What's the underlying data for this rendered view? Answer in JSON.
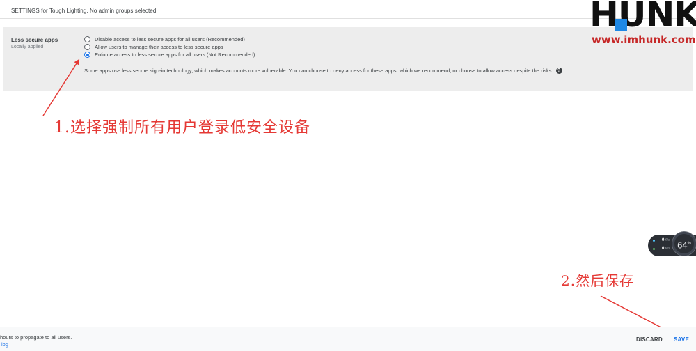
{
  "header": {
    "settings_text": "SETTINGS for Tough Lighting, No admin groups selected."
  },
  "setting": {
    "title": "Less secure apps",
    "subtitle": "Locally applied",
    "options": [
      {
        "label": "Disable access to less secure apps for all users (Recommended)",
        "checked": false
      },
      {
        "label": "Allow users to manage their access to less secure apps",
        "checked": false
      },
      {
        "label": "Enforce access to less secure apps for all users (Not Recommended)",
        "checked": true
      }
    ],
    "description": "Some apps use less secure sign-in technology, which makes accounts more vulnerable. You can choose to deny access for these apps, which we recommend, or choose to allow access despite the risks.",
    "help_icon": "?"
  },
  "annotations": {
    "step1": "1.选择强制所有用户登录低安全设备",
    "step2": "2.然后保存",
    "color": "#e53935"
  },
  "watermark": {
    "logo": "HUNK",
    "url": "www.imhunk.com"
  },
  "network_widget": {
    "upload": "0",
    "download": "0",
    "unit": "K/s",
    "gauge_value": "64",
    "gauge_unit": "%"
  },
  "footer": {
    "propagate_text": "hours to propagate to all users.",
    "link_text": "log",
    "discard_label": "DISCARD",
    "save_label": "SAVE"
  },
  "colors": {
    "accent": "#1a73e8",
    "panel_bg": "#ededed",
    "annotation_red": "#e53935",
    "logo_blue": "#1e88e5"
  }
}
